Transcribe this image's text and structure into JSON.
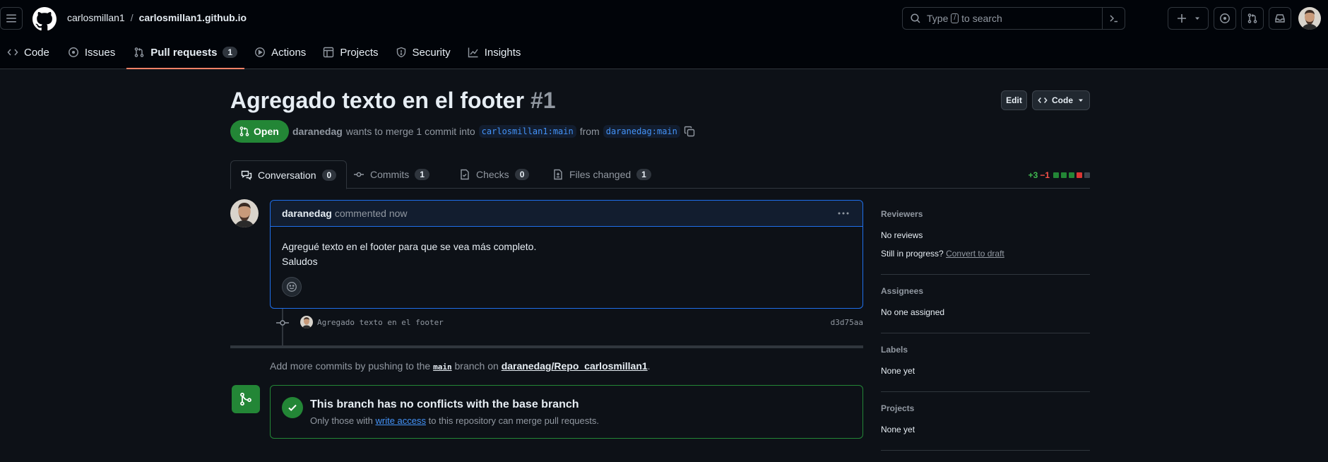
{
  "header": {
    "owner": "carlosmillan1",
    "separator": "/",
    "repo": "carlosmillan1.github.io",
    "search_placeholder_pre": "Type",
    "search_key": "/",
    "search_placeholder_post": "to search"
  },
  "repo_nav": {
    "items": [
      {
        "label": "Code"
      },
      {
        "label": "Issues"
      },
      {
        "label": "Pull requests",
        "count": "1"
      },
      {
        "label": "Actions"
      },
      {
        "label": "Projects"
      },
      {
        "label": "Security"
      },
      {
        "label": "Insights"
      }
    ]
  },
  "pr": {
    "title": "Agregado texto en el footer",
    "number": "#1",
    "edit_label": "Edit",
    "code_label": "Code",
    "state": "Open",
    "author": "daranedag",
    "meta_text": "wants to merge 1 commit into",
    "base_branch": "carlosmillan1:main",
    "from_text": "from",
    "head_branch": "daranedag:main"
  },
  "tabs": [
    {
      "label": "Conversation",
      "count": "0"
    },
    {
      "label": "Commits",
      "count": "1"
    },
    {
      "label": "Checks",
      "count": "0"
    },
    {
      "label": "Files changed",
      "count": "1"
    }
  ],
  "diffstat": {
    "additions": "+3",
    "deletions": "−1"
  },
  "comment": {
    "author": "daranedag",
    "time": "commented now",
    "line1": "Agregué texto en el footer para que se vea más completo.",
    "line2": "Saludos"
  },
  "commit": {
    "message": "Agregado texto en el footer",
    "sha": "d3d75aa"
  },
  "add_more": {
    "pre": "Add more commits by pushing to the",
    "branch": "main",
    "mid": "branch on",
    "repo": "daranedag/Repo_carlosmillan1",
    "post": "."
  },
  "merge": {
    "title": "This branch has no conflicts with the base branch",
    "sub_pre": "Only those with",
    "sub_link": "write access",
    "sub_post": "to this repository can merge pull requests."
  },
  "sidebar": {
    "reviewers_h": "Reviewers",
    "reviewers_v": "No reviews",
    "progress_q": "Still in progress?",
    "progress_link": "Convert to draft",
    "assignees_h": "Assignees",
    "assignees_v": "No one assigned",
    "labels_h": "Labels",
    "labels_v": "None yet",
    "projects_h": "Projects",
    "projects_v": "None yet"
  },
  "colors": {
    "accent": "#1f6feb",
    "success": "#238636",
    "nav_underline": "#f78166"
  }
}
